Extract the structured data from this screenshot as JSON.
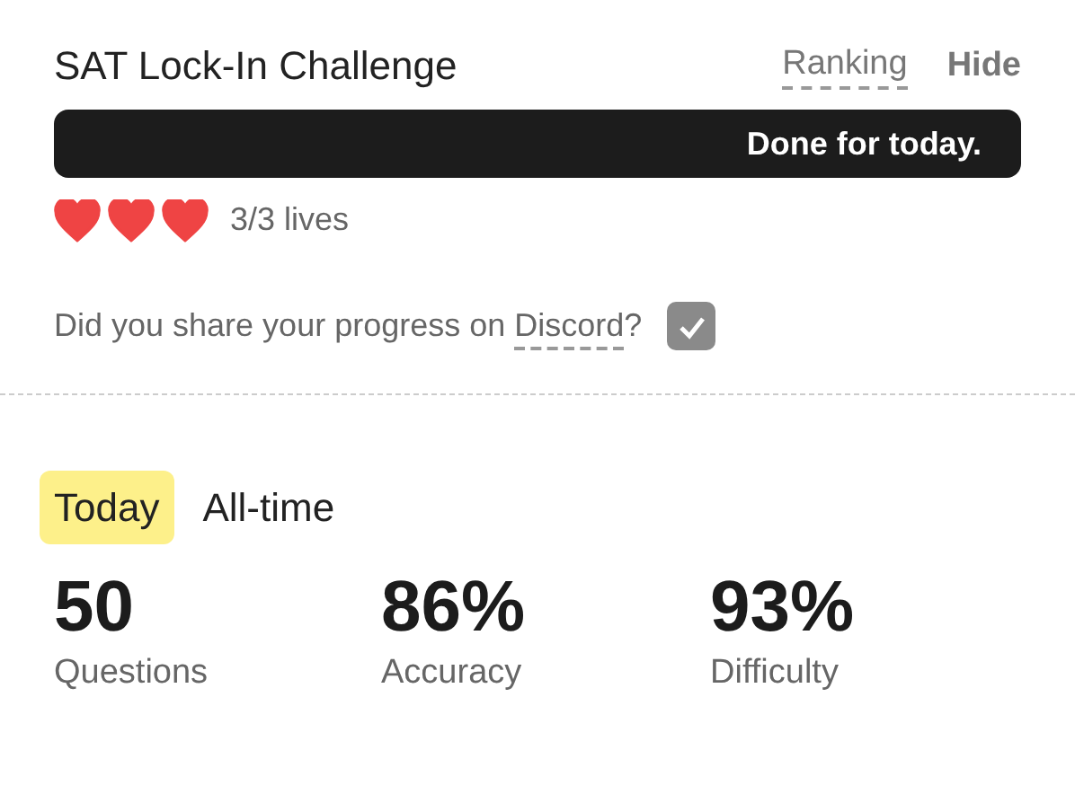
{
  "challenge": {
    "title": "SAT Lock-In Challenge",
    "links": [
      {
        "label": "Ranking",
        "kind": "dashed"
      },
      {
        "label": "Hide",
        "kind": "bold"
      }
    ],
    "progress": {
      "label": "Done for today."
    },
    "lives": {
      "hearts": [
        {
          "filled": true
        },
        {
          "filled": true
        },
        {
          "filled": true
        }
      ],
      "text": "3/3 lives"
    },
    "share": {
      "prefix": "Did you share your progress on",
      "link": "Discord",
      "suffix": "?",
      "checked": true
    }
  },
  "tabs": [
    {
      "label": "Today",
      "selected": true
    },
    {
      "label": "All-time",
      "selected": false
    }
  ],
  "stats": [
    {
      "value": "50",
      "label": "Questions"
    },
    {
      "value": "86%",
      "label": "Accuracy"
    },
    {
      "value": "93%",
      "label": "Difficulty"
    }
  ]
}
